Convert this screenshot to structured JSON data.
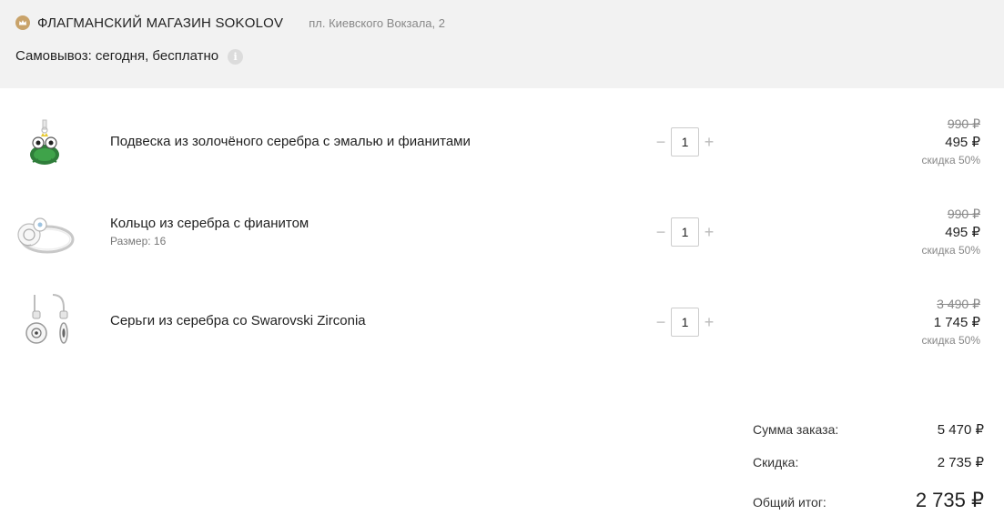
{
  "store": {
    "name": "ФЛАГМАНСКИЙ МАГАЗИН SOKOLOV",
    "address": "пл. Киевского Вокзала, 2",
    "icon": "crown-icon",
    "pickup": "Самовывоз: сегодня, бесплатно",
    "info_icon": "i"
  },
  "items": [
    {
      "name": "Подвеска из золочёного серебра с эмалью и фианитами",
      "size": "",
      "quantity": "1",
      "old_price": "990 ₽",
      "price": "495 ₽",
      "discount": "скидка 50%"
    },
    {
      "name": "Кольцо из серебра с фианитом",
      "size": "Размер: 16",
      "quantity": "1",
      "old_price": "990 ₽",
      "price": "495 ₽",
      "discount": "скидка 50%"
    },
    {
      "name": "Серьги из серебра со Swarovski Zirconia",
      "size": "",
      "quantity": "1",
      "old_price": "3 490 ₽",
      "price": "1 745 ₽",
      "discount": "скидка 50%"
    }
  ],
  "qty_controls": {
    "minus": "−",
    "plus": "+"
  },
  "summary": {
    "subtotal_label": "Сумма заказа:",
    "subtotal_value": "5 470 ₽",
    "discount_label": "Скидка:",
    "discount_value": "2 735 ₽",
    "total_label": "Общий итог:",
    "total_value": "2 735 ₽"
  },
  "colors": {
    "header_bg": "#f2f2f2",
    "brand_gold": "#c9a36a",
    "muted_text": "#888888"
  }
}
